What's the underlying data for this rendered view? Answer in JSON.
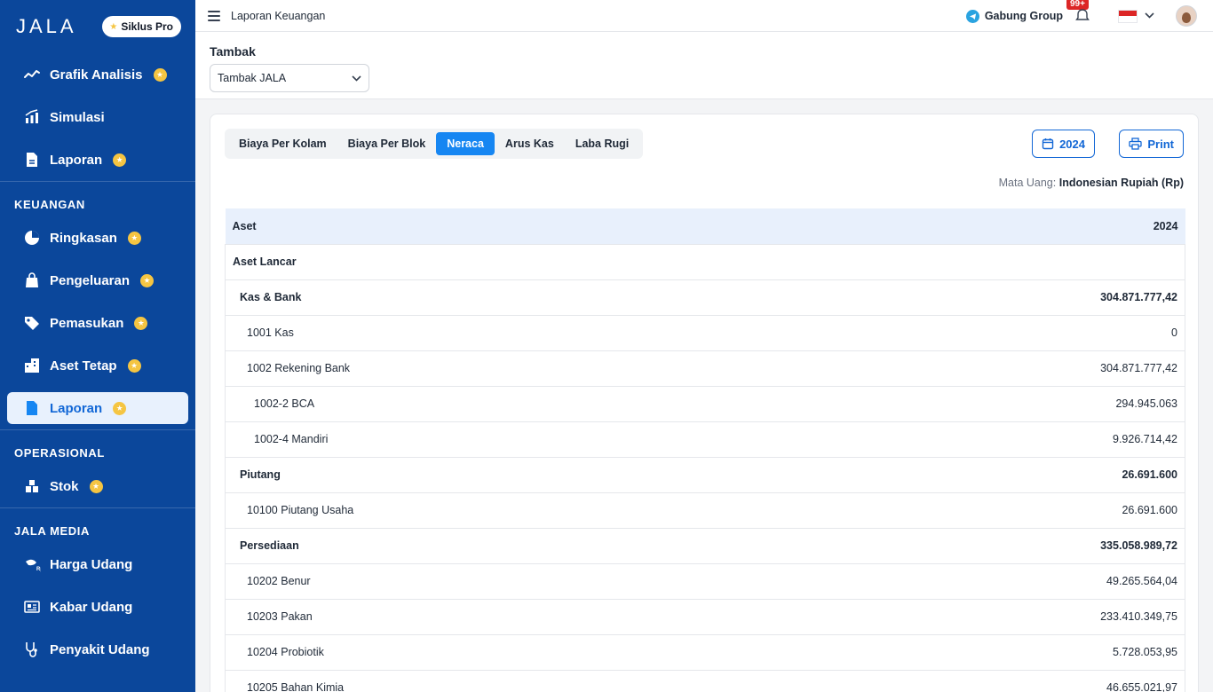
{
  "brand": {
    "logo": "JALA",
    "plan_badge": "Siklus Pro"
  },
  "sidebar": {
    "top_items": [
      {
        "label": "Grafik Analisis",
        "icon": "trend-icon",
        "pro": true
      },
      {
        "label": "Simulasi",
        "icon": "chart-icon",
        "pro": false
      },
      {
        "label": "Laporan",
        "icon": "document-icon",
        "pro": true
      }
    ],
    "sections": [
      {
        "title": "KEUANGAN",
        "items": [
          {
            "label": "Ringkasan",
            "icon": "pie-icon",
            "pro": true
          },
          {
            "label": "Pengeluaran",
            "icon": "bag-icon",
            "pro": true
          },
          {
            "label": "Pemasukan",
            "icon": "tag-icon",
            "pro": true
          },
          {
            "label": "Aset Tetap",
            "icon": "building-icon",
            "pro": true
          },
          {
            "label": "Laporan",
            "icon": "report-icon",
            "pro": true,
            "active": true
          }
        ]
      },
      {
        "title": "OPERASIONAL",
        "items": [
          {
            "label": "Stok",
            "icon": "boxes-icon",
            "pro": true
          }
        ]
      },
      {
        "title": "JALA MEDIA",
        "items": [
          {
            "label": "Harga Udang",
            "icon": "shrimp-price-icon",
            "pro": false
          },
          {
            "label": "Kabar Udang",
            "icon": "news-icon",
            "pro": false
          },
          {
            "label": "Penyakit Udang",
            "icon": "stethoscope-icon",
            "pro": false
          }
        ]
      }
    ]
  },
  "topbar": {
    "title": "Laporan Keuangan",
    "group_label": "Gabung Group",
    "notif_count": "99+"
  },
  "filter": {
    "label": "Tambak",
    "selected": "Tambak JALA"
  },
  "tabs": [
    {
      "label": "Biaya Per Kolam",
      "active": false
    },
    {
      "label": "Biaya Per Blok",
      "active": false
    },
    {
      "label": "Neraca",
      "active": true
    },
    {
      "label": "Arus Kas",
      "active": false
    },
    {
      "label": "Laba Rugi",
      "active": false
    }
  ],
  "actions": {
    "year": "2024",
    "print": "Print"
  },
  "currency": {
    "label": "Mata Uang:",
    "value": "Indonesian Rupiah (Rp)"
  },
  "table": {
    "headers": [
      "Aset",
      "2024"
    ],
    "rows": [
      {
        "name": "Aset Lancar",
        "value": "",
        "level": 1
      },
      {
        "name": "Kas & Bank",
        "value": "304.871.777,42",
        "level": 2
      },
      {
        "name": "1001 Kas",
        "value": "0",
        "level": 3
      },
      {
        "name": "1002 Rekening Bank",
        "value": "304.871.777,42",
        "level": 3
      },
      {
        "name": "1002-2 BCA",
        "value": "294.945.063",
        "level": 4
      },
      {
        "name": "1002-4 Mandiri",
        "value": "9.926.714,42",
        "level": 4
      },
      {
        "name": "Piutang",
        "value": "26.691.600",
        "level": 2
      },
      {
        "name": "10100 Piutang Usaha",
        "value": "26.691.600",
        "level": 3
      },
      {
        "name": "Persediaan",
        "value": "335.058.989,72",
        "level": 2
      },
      {
        "name": "10202 Benur",
        "value": "49.265.564,04",
        "level": 3
      },
      {
        "name": "10203 Pakan",
        "value": "233.410.349,75",
        "level": 3
      },
      {
        "name": "10204 Probiotik",
        "value": "5.728.053,95",
        "level": 3
      },
      {
        "name": "10205 Bahan Kimia",
        "value": "46.655.021,97",
        "level": 3
      }
    ]
  },
  "colors": {
    "sidebar": "#0b479b",
    "accent": "#1686f2",
    "pro_star": "#f5c542"
  }
}
